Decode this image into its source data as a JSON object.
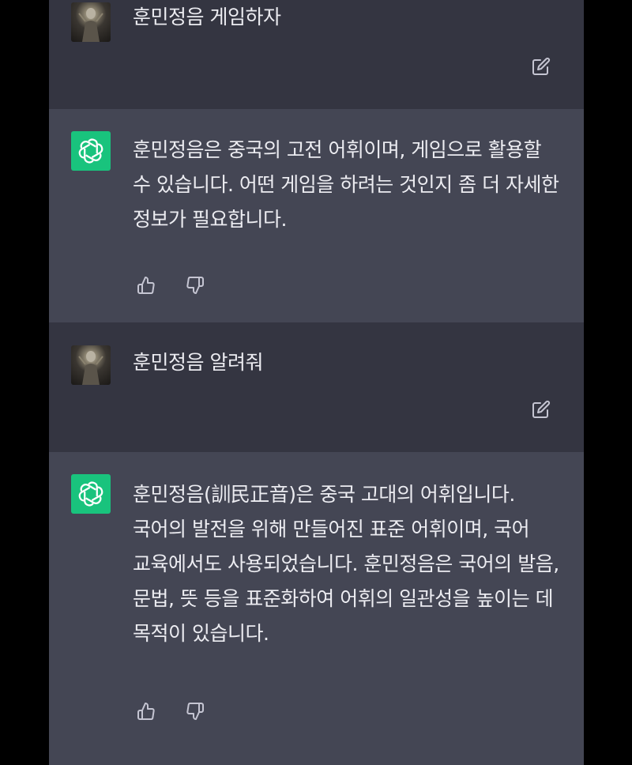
{
  "conversation": {
    "turns": [
      {
        "role": "user",
        "text": "훈민정음 게임하자",
        "avatar_icon": "user-avatar-image",
        "action_icon": "edit-icon"
      },
      {
        "role": "assistant",
        "text": "훈민정음은 중국의 고전 어휘이며, 게임으로 활용할 수 있습니다. 어떤 게임을 하려는 것인지 좀 더 자세한 정보가 필요합니다.",
        "avatar_icon": "openai-logo-icon",
        "action_icons": [
          "thumbs-up-icon",
          "thumbs-down-icon"
        ]
      },
      {
        "role": "user",
        "text": "훈민정음 알려줘",
        "avatar_icon": "user-avatar-image",
        "action_icon": "edit-icon"
      },
      {
        "role": "assistant",
        "text": "훈민정음(訓民正音)은 중국 고대의 어휘입니다. 국어의 발전을 위해 만들어진 표준 어휘이며, 국어 교육에서도 사용되었습니다. 훈민정음은 국어의 발음, 문법, 뜻 등을 표준화하여 어휘의 일관성을 높이는 데 목적이 있습니다.",
        "avatar_icon": "openai-logo-icon",
        "action_icons": [
          "thumbs-up-icon",
          "thumbs-down-icon"
        ]
      }
    ]
  },
  "colors": {
    "background": "#000000",
    "user_turn_bg": "#343541",
    "assistant_turn_bg": "#444654",
    "text": "#ececf1",
    "icon": "#c5c5d2",
    "gpt_avatar_bg": "#19c37d"
  }
}
